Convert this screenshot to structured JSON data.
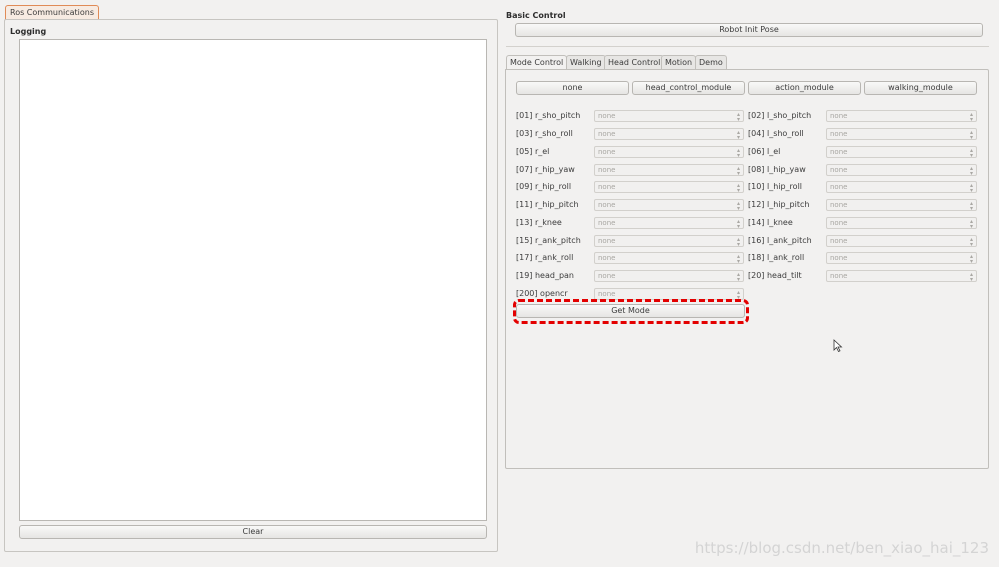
{
  "left": {
    "tab_label": "Ros Communications",
    "logging_label": "Logging",
    "clear_label": "Clear"
  },
  "right": {
    "basic_control_label": "Basic Control",
    "init_pose_label": "Robot Init Pose",
    "tabs": [
      {
        "label": "Mode Control",
        "active": true
      },
      {
        "label": "Walking",
        "active": false
      },
      {
        "label": "Head Control",
        "active": false
      },
      {
        "label": "Motion",
        "active": false
      },
      {
        "label": "Demo",
        "active": false
      }
    ],
    "module_buttons": [
      "none",
      "head_control_module",
      "action_module",
      "walking_module"
    ],
    "joints": [
      {
        "label": "[01] r_sho_pitch",
        "value": "none"
      },
      {
        "label": "[02] l_sho_pitch",
        "value": "none"
      },
      {
        "label": "[03] r_sho_roll",
        "value": "none"
      },
      {
        "label": "[04] l_sho_roll",
        "value": "none"
      },
      {
        "label": "[05] r_el",
        "value": "none"
      },
      {
        "label": "[06] l_el",
        "value": "none"
      },
      {
        "label": "[07] r_hip_yaw",
        "value": "none"
      },
      {
        "label": "[08] l_hip_yaw",
        "value": "none"
      },
      {
        "label": "[09] r_hip_roll",
        "value": "none"
      },
      {
        "label": "[10] l_hip_roll",
        "value": "none"
      },
      {
        "label": "[11] r_hip_pitch",
        "value": "none"
      },
      {
        "label": "[12] l_hip_pitch",
        "value": "none"
      },
      {
        "label": "[13] r_knee",
        "value": "none"
      },
      {
        "label": "[14] l_knee",
        "value": "none"
      },
      {
        "label": "[15] r_ank_pitch",
        "value": "none"
      },
      {
        "label": "[16] l_ank_pitch",
        "value": "none"
      },
      {
        "label": "[17] r_ank_roll",
        "value": "none"
      },
      {
        "label": "[18] l_ank_roll",
        "value": "none"
      },
      {
        "label": "[19] head_pan",
        "value": "none"
      },
      {
        "label": "[20] head_tilt",
        "value": "none"
      },
      {
        "label": "[200] opencr",
        "value": "none"
      }
    ],
    "get_mode_label": "Get Mode"
  },
  "watermark": "https://blog.csdn.net/ben_xiao_hai_123",
  "colors": {
    "highlight": "#e30000",
    "active_tab_border": "#e08b57"
  }
}
